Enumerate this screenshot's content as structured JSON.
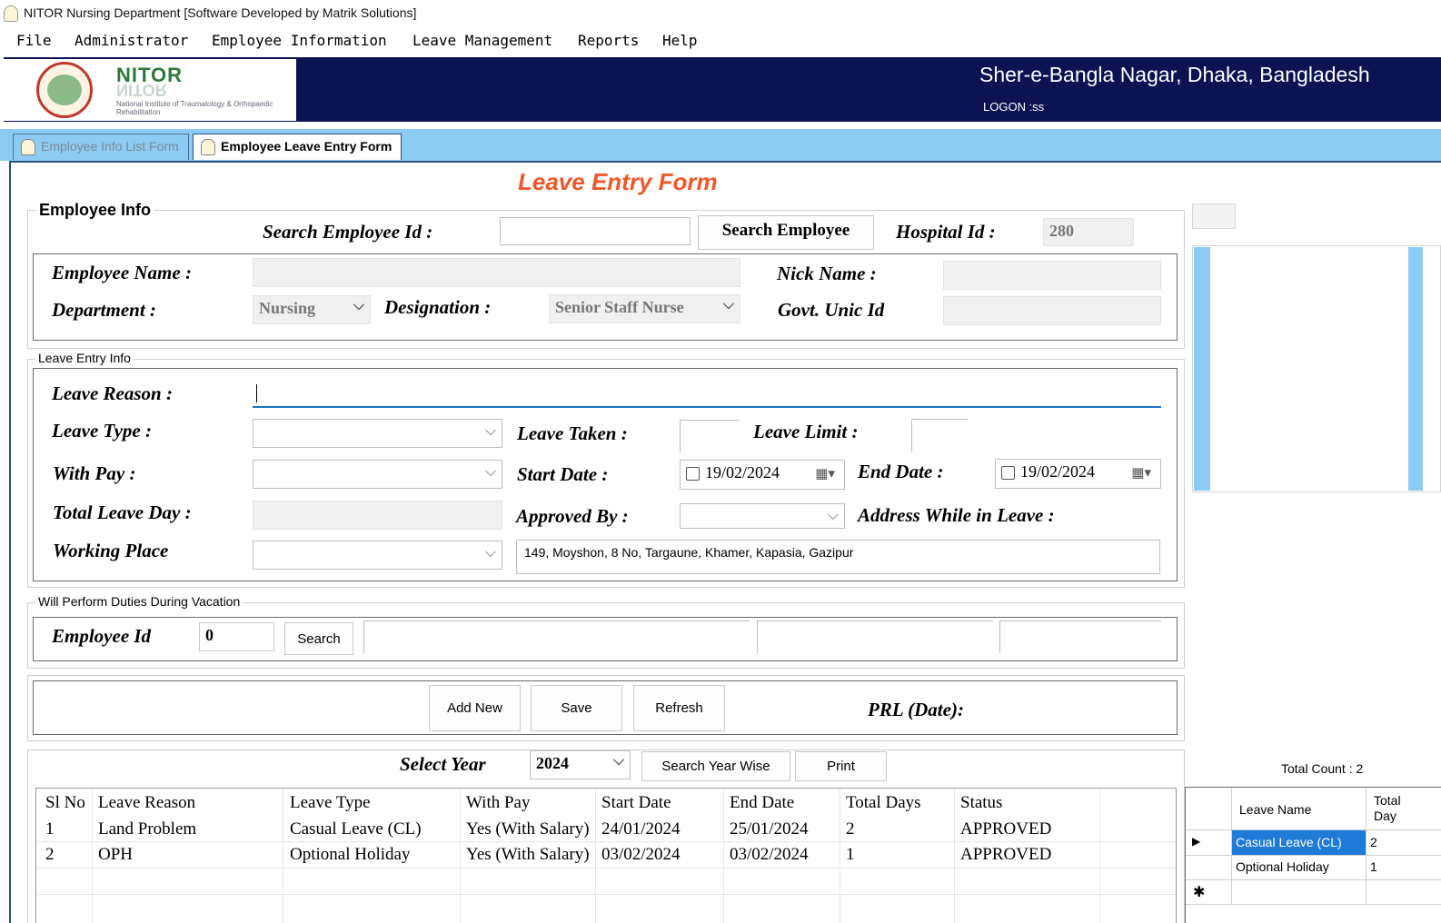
{
  "window": {
    "title": "NITOR Nursing Department [Software Developed by Matrik Solutions]"
  },
  "menu": [
    "File",
    "Administrator",
    "Employee Information",
    "Leave Management",
    "Reports",
    "Help"
  ],
  "header": {
    "logo_name": "NITOR",
    "logo_sub": "National Institute of Traumatology & Orthopaedic Rehabilitation",
    "location": "Sher-e-Bangla Nagar, Dhaka, Bangladesh",
    "logon": "LOGON :ss"
  },
  "tabs": [
    {
      "label": "Employee Info List Form",
      "active": false
    },
    {
      "label": "Employee Leave Entry Form",
      "active": true
    }
  ],
  "form_title": "Leave Entry Form",
  "employee_info": {
    "legend": "Employee Info",
    "search_label": "Search Employee Id :",
    "search_value": "",
    "search_button": "Search Employee",
    "hospital_id_label": "Hospital Id :",
    "hospital_id_value": "280",
    "name_label": "Employee Name :",
    "name_value": "",
    "nick_label": "Nick Name :",
    "nick_value": "",
    "department_label": "Department :",
    "department_value": "Nursing",
    "designation_label": "Designation :",
    "designation_value": "Senior Staff Nurse",
    "govt_id_label": "Govt. Unic Id",
    "govt_id_value": ""
  },
  "leave_entry": {
    "legend": "Leave Entry Info",
    "reason_label": "Leave Reason :",
    "reason_value": "",
    "type_label": "Leave Type :",
    "type_value": "",
    "taken_label": "Leave Taken :",
    "taken_value": "",
    "limit_label": "Leave Limit :",
    "limit_value": "",
    "withpay_label": "With Pay :",
    "withpay_value": "",
    "start_label": "Start Date :",
    "start_value": "19/02/2024",
    "end_label": "End Date :",
    "end_value": "19/02/2024",
    "total_label": "Total Leave Day :",
    "total_value": "",
    "approved_label": "Approved By :",
    "approved_value": "",
    "address_label": "Address While in Leave :",
    "address_value": "149, Moyshon, 8 No, Targaune, Khamer, Kapasia, Gazipur",
    "working_label": "Working Place",
    "working_value": ""
  },
  "duties": {
    "legend": "Will Perform Duties During Vacation",
    "emp_label": "Employee Id",
    "emp_value": "0",
    "search_button": "Search"
  },
  "actions": {
    "add_new": "Add New",
    "save": "Save",
    "refresh": "Refresh",
    "prl_label": "PRL (Date):"
  },
  "year_filter": {
    "label": "Select Year",
    "value": "2024",
    "search_button": "Search Year Wise",
    "print_button": "Print"
  },
  "leave_table": {
    "columns": [
      "Sl No",
      "Leave Reason",
      "Leave Type",
      "With Pay",
      "Start Date",
      "End Date",
      "Total Days",
      "Status"
    ],
    "rows": [
      [
        "1",
        "Land Problem",
        "Casual Leave (CL)",
        "Yes (With Salary)",
        "24/01/2024",
        "25/01/2024",
        "2",
        "APPROVED"
      ],
      [
        "2",
        "OPH",
        "Optional Holiday",
        "Yes (With Salary)",
        "03/02/2024",
        "03/02/2024",
        "1",
        "APPROVED"
      ]
    ]
  },
  "summary": {
    "total_count": "Total Count : 2",
    "columns": [
      "Leave Name",
      "Total Day"
    ],
    "rows": [
      [
        "Casual Leave (CL)",
        "2"
      ],
      [
        "Optional Holiday",
        "1"
      ]
    ]
  },
  "colors": {
    "banner": "#0b1352",
    "tabstrip": "#8ccbf2",
    "form_title": "#f0582a",
    "selection": "#1e7bd8"
  }
}
